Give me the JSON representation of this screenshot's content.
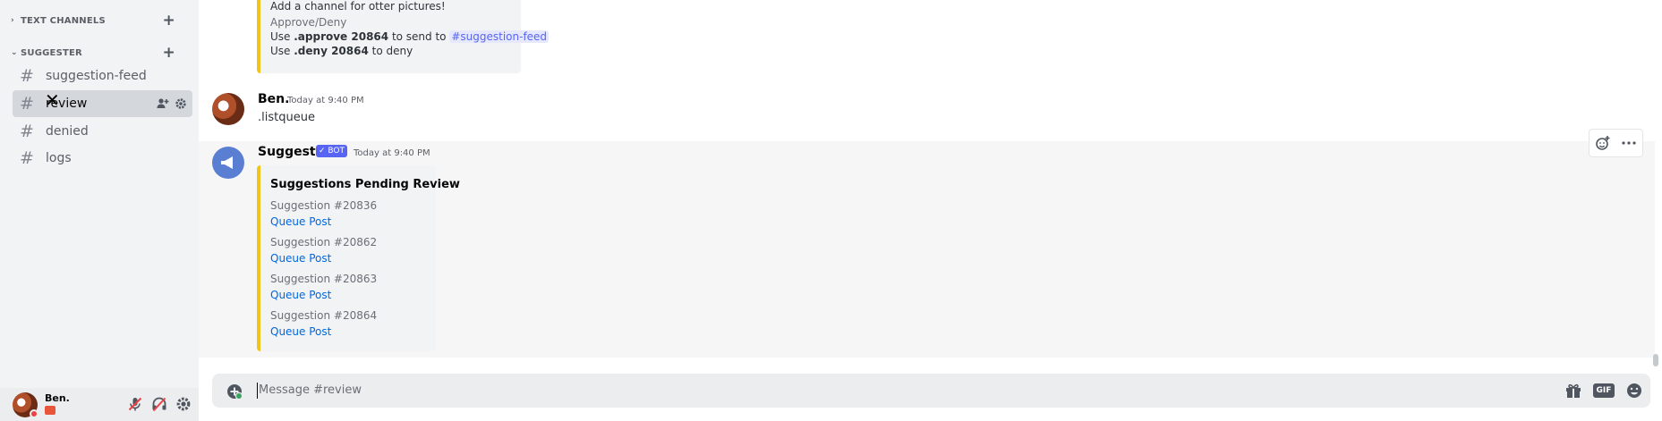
{
  "sidebar": {
    "categories": [
      {
        "label": "TEXT CHANNELS"
      },
      {
        "label": "SUGGESTER"
      }
    ],
    "channels": [
      {
        "label": "suggestion-feed"
      },
      {
        "label": "review"
      },
      {
        "label": "denied"
      },
      {
        "label": "logs"
      }
    ]
  },
  "user_panel": {
    "name": "Ben."
  },
  "messages": {
    "top_embed": {
      "line1": "Add a channel for otter pictures!",
      "line2": "Approve/Deny",
      "line3_prefix": "Use ",
      "line3_cmd": ".approve 20864",
      "line3_mid": " to send to ",
      "line3_mention": "#suggestion-feed",
      "line4_prefix": "Use ",
      "line4_cmd": ".deny 20864",
      "line4_suffix": " to deny"
    },
    "ben": {
      "username": "Ben.",
      "timestamp": "Today at 9:40 PM",
      "text": ".listqueue"
    },
    "suggester": {
      "username": "Suggester",
      "bot_badge": "✓ BOT",
      "timestamp": "Today at 9:40 PM",
      "embed_title": "Suggestions Pending Review",
      "items": [
        {
          "title": "Suggestion #20836",
          "link": "Queue Post"
        },
        {
          "title": "Suggestion #20862",
          "link": "Queue Post"
        },
        {
          "title": "Suggestion #20863",
          "link": "Queue Post"
        },
        {
          "title": "Suggestion #20864",
          "link": "Queue Post"
        }
      ]
    }
  },
  "composer": {
    "placeholder": "Message #review"
  },
  "icons": {
    "category_chevron": "chevron-down-icon",
    "add": "plus-icon",
    "channel": "hash-icon",
    "invite": "add-member-icon",
    "settings": "gear-icon",
    "mute": "mic-muted-icon",
    "deafen": "headphones-muted-icon",
    "react": "add-reaction-icon",
    "more": "more-icon",
    "upload": "plus-circle-icon",
    "gift": "gift-icon",
    "gif": "gif-icon",
    "emoji": "emoji-icon"
  },
  "colors": {
    "sidebar_bg": "#f2f3f5",
    "selected_channel": "#d4d7dc",
    "embed_accent": "#f0c419",
    "blurple": "#5865f2",
    "link": "#0068e0"
  }
}
